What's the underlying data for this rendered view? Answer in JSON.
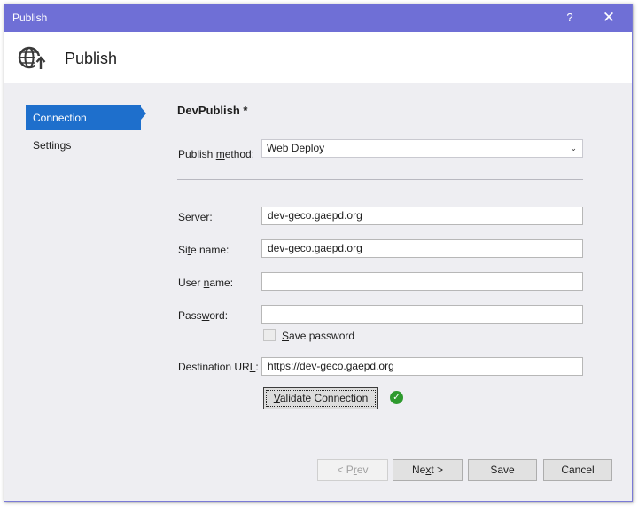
{
  "window": {
    "title": "Publish",
    "help_glyph": "?",
    "close_glyph": "✕"
  },
  "header": {
    "title": "Publish",
    "icon": "globe-publish-icon"
  },
  "nav": {
    "items": [
      {
        "label": "Connection",
        "active": true
      },
      {
        "label": "Settings",
        "active": false
      }
    ]
  },
  "form": {
    "profile_name": "DevPublish *",
    "publish_method": {
      "label_pre": "Publish ",
      "label_key": "m",
      "label_post": "ethod:",
      "value": "Web Deploy"
    },
    "server": {
      "label_pre": "S",
      "label_key": "e",
      "label_post": "rver:",
      "value": "dev-geco.gaepd.org"
    },
    "site_name": {
      "label_pre": "Si",
      "label_key": "t",
      "label_post": "e name:",
      "value": "dev-geco.gaepd.org"
    },
    "user_name": {
      "label_pre": "User ",
      "label_key": "n",
      "label_post": "ame:",
      "value": ""
    },
    "password": {
      "label_pre": "Pass",
      "label_key": "w",
      "label_post": "ord:",
      "value": ""
    },
    "save_password": {
      "label_key": "S",
      "label_post": "ave password",
      "checked": false
    },
    "destination_url": {
      "label_pre": "Destination UR",
      "label_key": "L",
      "label_post": ":",
      "value": "https://dev-geco.gaepd.org"
    },
    "validate": {
      "label_pre": "",
      "label_key": "V",
      "label_post": "alidate Connection",
      "status_icon": "check-circle-icon",
      "status_color": "#2e9a2e"
    }
  },
  "footer": {
    "prev": {
      "pre": "< P",
      "key": "r",
      "post": "ev"
    },
    "next": {
      "pre": "Ne",
      "key": "x",
      "post": "t >"
    },
    "save": {
      "label": "Save"
    },
    "cancel": {
      "label": "Cancel"
    }
  },
  "colors": {
    "titlebar": "#6f6fd6",
    "accent": "#1e6fcc"
  }
}
